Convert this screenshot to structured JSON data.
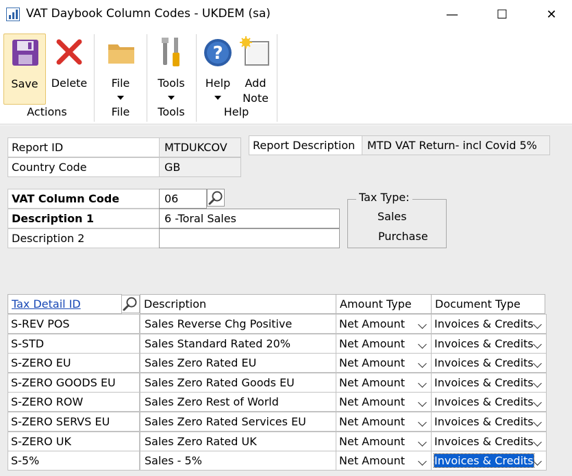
{
  "window": {
    "title": "VAT Daybook Column Codes  -  UKDEM (sa)",
    "minimize": "—",
    "maximize": "☐",
    "close": "✕"
  },
  "ribbon": {
    "save": "Save",
    "delete": "Delete",
    "file": "File",
    "tools": "Tools",
    "help": "Help",
    "add_note_line1": "Add",
    "add_note_line2": "Note",
    "groups": {
      "actions": "Actions",
      "file": "File",
      "tools": "Tools",
      "help": "Help"
    }
  },
  "form": {
    "report_id_label": "Report ID",
    "report_id_value": "MTDUKCOV",
    "country_code_label": "Country Code",
    "country_code_value": "GB",
    "report_description_label": "Report Description",
    "report_description_value": "MTD VAT Return- incl Covid 5%",
    "vat_column_code_label": "VAT Column Code",
    "vat_column_code_value": "06",
    "description1_label": "Description 1",
    "description1_value": "6 -Toral Sales",
    "description2_label": "Description 2",
    "description2_value": "",
    "tax_type_label": "Tax Type:",
    "tax_type_sales": "Sales",
    "tax_type_purchase": "Purchase"
  },
  "grid": {
    "headers": {
      "tax_detail_id": "Tax Detail ID",
      "description": "Description",
      "amount_type": "Amount Type",
      "document_type": "Document Type"
    },
    "rows": [
      {
        "id": "S-REV POS",
        "description": "Sales Reverse Chg Positive",
        "amount_type": "Net Amount",
        "document_type": "Invoices & Credits"
      },
      {
        "id": "S-STD",
        "description": "Sales Standard Rated 20%",
        "amount_type": "Net Amount",
        "document_type": "Invoices & Credits"
      },
      {
        "id": "S-ZERO EU",
        "description": "Sales Zero Rated EU",
        "amount_type": "Net Amount",
        "document_type": "Invoices & Credits"
      },
      {
        "id": "S-ZERO GOODS EU",
        "description": "Sales Zero Rated Goods EU",
        "amount_type": "Net Amount",
        "document_type": "Invoices & Credits"
      },
      {
        "id": "S-ZERO ROW",
        "description": "Sales Zero Rest of World",
        "amount_type": "Net Amount",
        "document_type": "Invoices & Credits"
      },
      {
        "id": "S-ZERO SERVS EU",
        "description": "Sales Zero Rated Services EU",
        "amount_type": "Net Amount",
        "document_type": "Invoices & Credits"
      },
      {
        "id": "S-ZERO UK",
        "description": "Sales Zero Rated UK",
        "amount_type": "Net Amount",
        "document_type": "Invoices & Credits"
      },
      {
        "id": "S-5%",
        "description": "Sales - 5%",
        "amount_type": "Net Amount",
        "document_type": "Invoices & Credits"
      }
    ]
  },
  "colors": {
    "accent_selected": "#0b5fd1",
    "ribbon_selected": "#fdf0c6",
    "form_background": "#ececec"
  }
}
